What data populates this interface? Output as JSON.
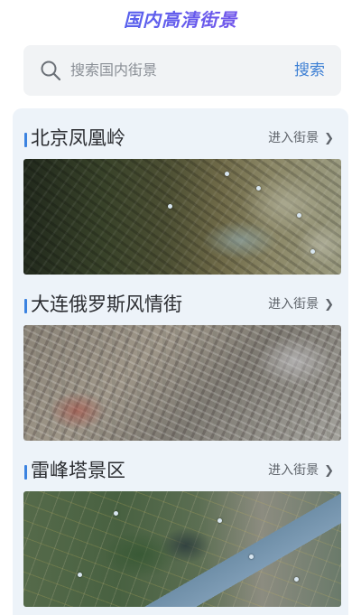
{
  "header": {
    "title": "国内高清街景"
  },
  "search": {
    "placeholder": "搜索国内街景",
    "button_label": "搜索",
    "icon": "search-icon"
  },
  "locations": [
    {
      "name": "北京凤凰岭",
      "enter_label": "进入街景",
      "image": "satellite-beijing-fenghuangling"
    },
    {
      "name": "大连俄罗斯风情街",
      "enter_label": "进入街景",
      "image": "satellite-dalian-russian-street"
    },
    {
      "name": "雷峰塔景区",
      "enter_label": "进入街景",
      "image": "satellite-leifeng-pagoda"
    }
  ],
  "colors": {
    "accent": "#3d7fd4",
    "title_gradient_start": "#3d6ff0",
    "title_gradient_end": "#8a47e8",
    "section_bar": "#3a82e0"
  }
}
